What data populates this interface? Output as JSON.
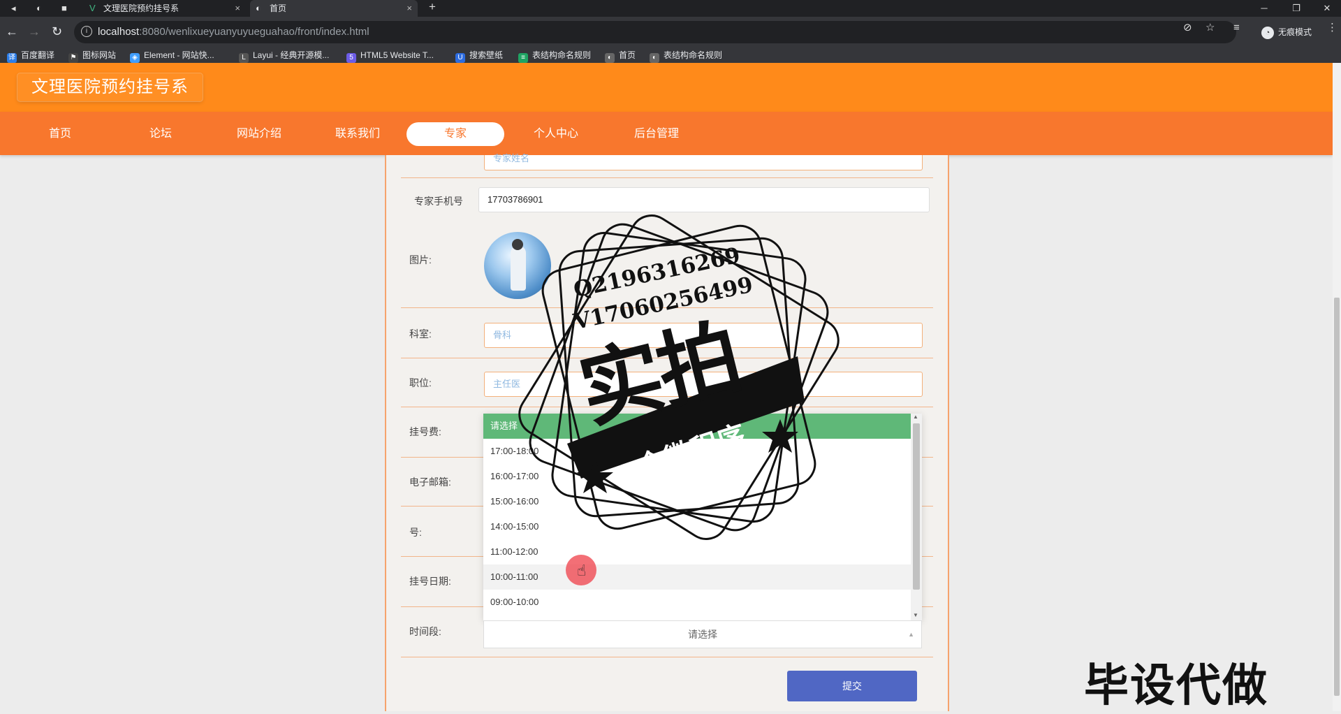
{
  "browser": {
    "tabs": [
      {
        "title": "文理医院预约挂号系",
        "close": "×"
      },
      {
        "title": "首页",
        "close": "×"
      }
    ],
    "new_tab": "+",
    "window_buttons": [
      "─",
      "❐",
      "✕"
    ],
    "url_host": "localhost",
    "url_rest": ":8080/wenlixueyuanyuyueguahao/front/index.html",
    "incognito_label": "无痕模式",
    "bookmarks": [
      {
        "label": "百度翻译",
        "color": "#2b7de9"
      },
      {
        "label": "图标网站",
        "color": "#444444"
      },
      {
        "label": "Element - 网站快...",
        "color": "#409eff"
      },
      {
        "label": "Layui - 经典开源模...",
        "color": "#555555"
      },
      {
        "label": "HTML5 Website T...",
        "color": "#6c5ce7"
      },
      {
        "label": "搜索壁纸",
        "color": "#2d6cdf"
      },
      {
        "label": "表结构命名规则",
        "color": "#1fa463"
      },
      {
        "label": "首页",
        "color": "#666666"
      },
      {
        "label": "表结构命名规则",
        "color": "#666666"
      }
    ]
  },
  "site": {
    "brand": "文理医院预约挂号系",
    "nav": [
      "首页",
      "论坛",
      "网站介绍",
      "联系我们",
      "专家",
      "个人中心",
      "后台管理"
    ],
    "active_nav": "专家"
  },
  "form": {
    "name_placeholder": "专家姓名",
    "phone_label": "专家手机号",
    "phone_value": "17703786901",
    "image_label": "图片:",
    "dept_label": "科室:",
    "dept_value": "骨科",
    "position_label": "职位:",
    "position_value": "主任医",
    "fee_label": "挂号费:",
    "email_label": "电子邮箱:",
    "number_label": "号:",
    "date_label": "挂号日期:",
    "time_label": "时间段:",
    "select_placeholder": "请选择",
    "dropdown_header": "请选择",
    "dropdown_options": [
      "17:00-18:00",
      "16:00-17:00",
      "15:00-16:00",
      "14:00-15:00",
      "11:00-12:00",
      "10:00-11:00",
      "09:00-10:00"
    ],
    "submit": "提交"
  },
  "watermark": {
    "qq": "Q2196316269",
    "vx": "V17060256499",
    "big": "实拍",
    "ribbon": "全微程序",
    "corner": "毕设代做"
  }
}
